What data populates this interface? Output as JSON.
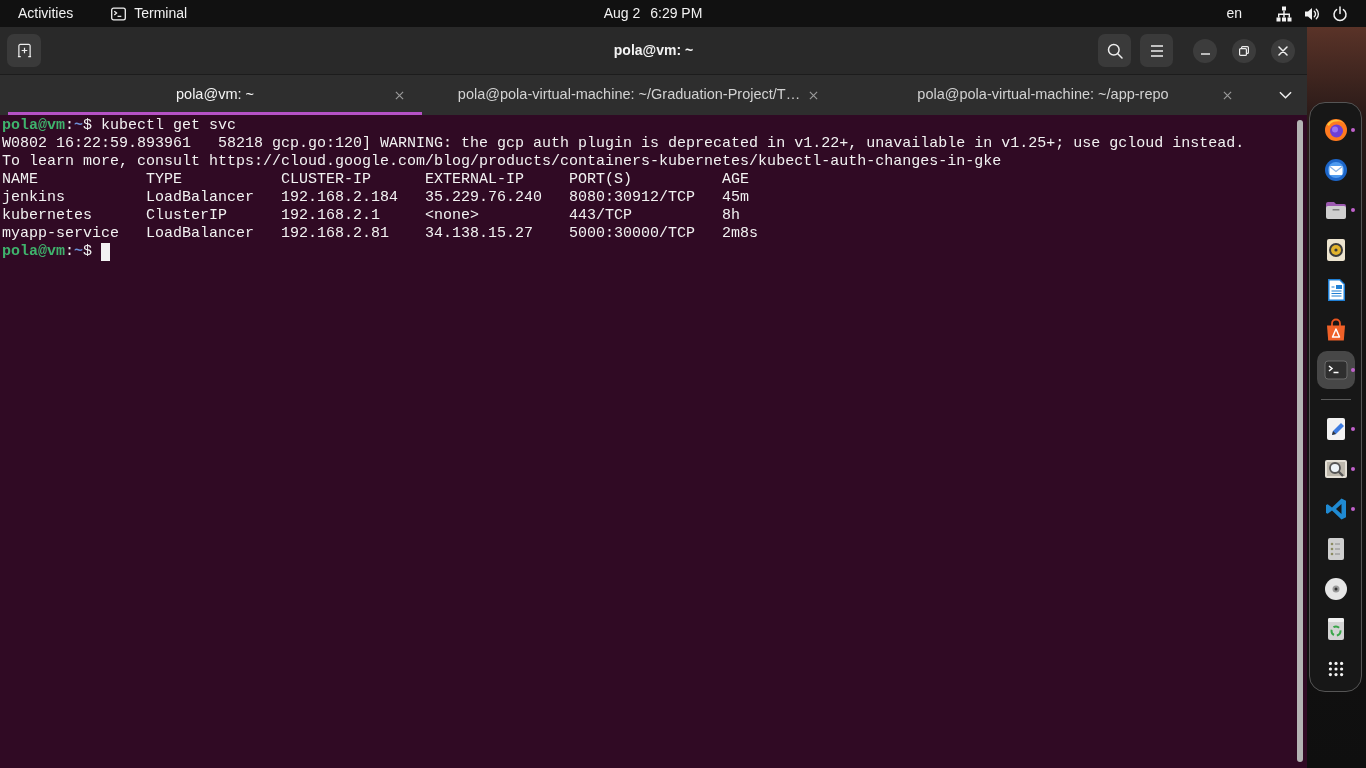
{
  "top_bar": {
    "activities": "Activities",
    "app_menu": "Terminal",
    "date": "Aug 2",
    "time": "6:29 PM",
    "input_source": "en"
  },
  "window": {
    "title": "pola@vm: ~"
  },
  "tabs": [
    {
      "label": "pola@vm: ~",
      "selected": true
    },
    {
      "label": "pola@pola-virtual-machine: ~/Graduation-Project/T…",
      "selected": false
    },
    {
      "label": "pola@pola-virtual-machine: ~/app-repo",
      "selected": false
    }
  ],
  "terminal": {
    "lines": [
      {
        "kind": "prompt",
        "user_host": "pola@vm",
        "separator": ":",
        "path": "~",
        "symbol": "$",
        "command": "kubectl get svc",
        "cursor": false
      },
      {
        "kind": "text",
        "text": "W0802 16:22:59.893961   58218 gcp.go:120] WARNING: the gcp auth plugin is deprecated in v1.22+, unavailable in v1.25+; use gcloud instead."
      },
      {
        "kind": "text",
        "text": "To learn more, consult https://cloud.google.com/blog/products/containers-kubernetes/kubectl-auth-changes-in-gke"
      },
      {
        "kind": "table",
        "columns": [
          "NAME",
          "TYPE",
          "CLUSTER-IP",
          "EXTERNAL-IP",
          "PORT(S)",
          "AGE"
        ],
        "rows": [
          [
            "jenkins",
            "LoadBalancer",
            "192.168.2.184",
            "35.229.76.240",
            "8080:30912/TCP",
            "45m"
          ],
          [
            "kubernetes",
            "ClusterIP",
            "192.168.2.1",
            "<none>",
            "443/TCP",
            "8h"
          ],
          [
            "myapp-service",
            "LoadBalancer",
            "192.168.2.81",
            "34.138.15.27",
            "5000:30000/TCP",
            "2m8s"
          ]
        ]
      },
      {
        "kind": "prompt",
        "user_host": "pola@vm",
        "separator": ":",
        "path": "~",
        "symbol": "$",
        "cursor": true
      }
    ]
  },
  "dock": {
    "sections": [
      {
        "items": [
          {
            "kind": "browser",
            "running": true,
            "selected": false
          },
          {
            "kind": "mail",
            "running": false,
            "selected": false
          },
          {
            "kind": "files",
            "running": true,
            "selected": false
          },
          {
            "kind": "music",
            "running": false,
            "selected": false
          },
          {
            "kind": "office",
            "running": false,
            "selected": false
          },
          {
            "kind": "store",
            "running": false,
            "selected": false
          },
          {
            "kind": "terminal",
            "running": true,
            "selected": true
          }
        ]
      },
      {
        "items": [
          {
            "kind": "editor",
            "running": true,
            "selected": false
          },
          {
            "kind": "viewer",
            "running": true,
            "selected": false
          },
          {
            "kind": "code",
            "running": true,
            "selected": false
          },
          {
            "kind": "panel",
            "running": false,
            "selected": false
          },
          {
            "kind": "disc",
            "running": false,
            "selected": false
          },
          {
            "kind": "trash",
            "running": false,
            "selected": false
          }
        ]
      }
    ]
  }
}
